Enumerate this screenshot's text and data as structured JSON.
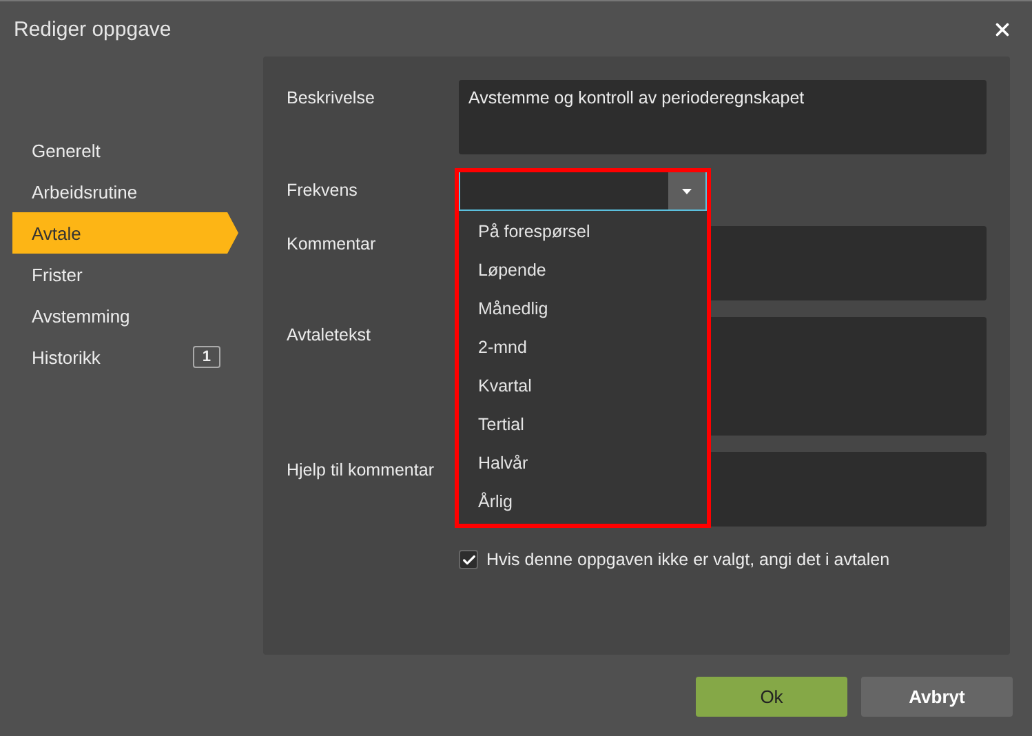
{
  "window": {
    "title": "Rediger oppgave"
  },
  "sidebar": {
    "items": [
      {
        "label": "Generelt",
        "selected": false
      },
      {
        "label": "Arbeidsrutine",
        "selected": false
      },
      {
        "label": "Avtale",
        "selected": true
      },
      {
        "label": "Frister",
        "selected": false
      },
      {
        "label": "Avstemming",
        "selected": false
      },
      {
        "label": "Historikk",
        "selected": false,
        "badge": "1"
      }
    ]
  },
  "fields": [
    {
      "label": "Beskrivelse",
      "kind": "textarea",
      "value": "Avstemme og kontroll av perioderegnskapet"
    },
    {
      "label": "Frekvens",
      "kind": "select",
      "expanded": true,
      "options": [
        "På forespørsel",
        "Løpende",
        "Månedlig",
        "2-mnd",
        "Kvartal",
        "Tertial",
        "Halvår",
        "Årlig"
      ]
    },
    {
      "label": "Kommentar",
      "kind": "textarea"
    },
    {
      "label": "Avtaletekst",
      "kind": "textarea-tall"
    },
    {
      "label": "Hjelp til kommentar",
      "kind": "textarea"
    }
  ],
  "checkbox": {
    "label": "Hvis denne oppgaven ikke er valgt, angi det i avtalen",
    "checked": true
  },
  "buttons": [
    {
      "label": "Ok",
      "kind": "primary"
    },
    {
      "label": "Avbryt",
      "kind": "secondary"
    }
  ]
}
